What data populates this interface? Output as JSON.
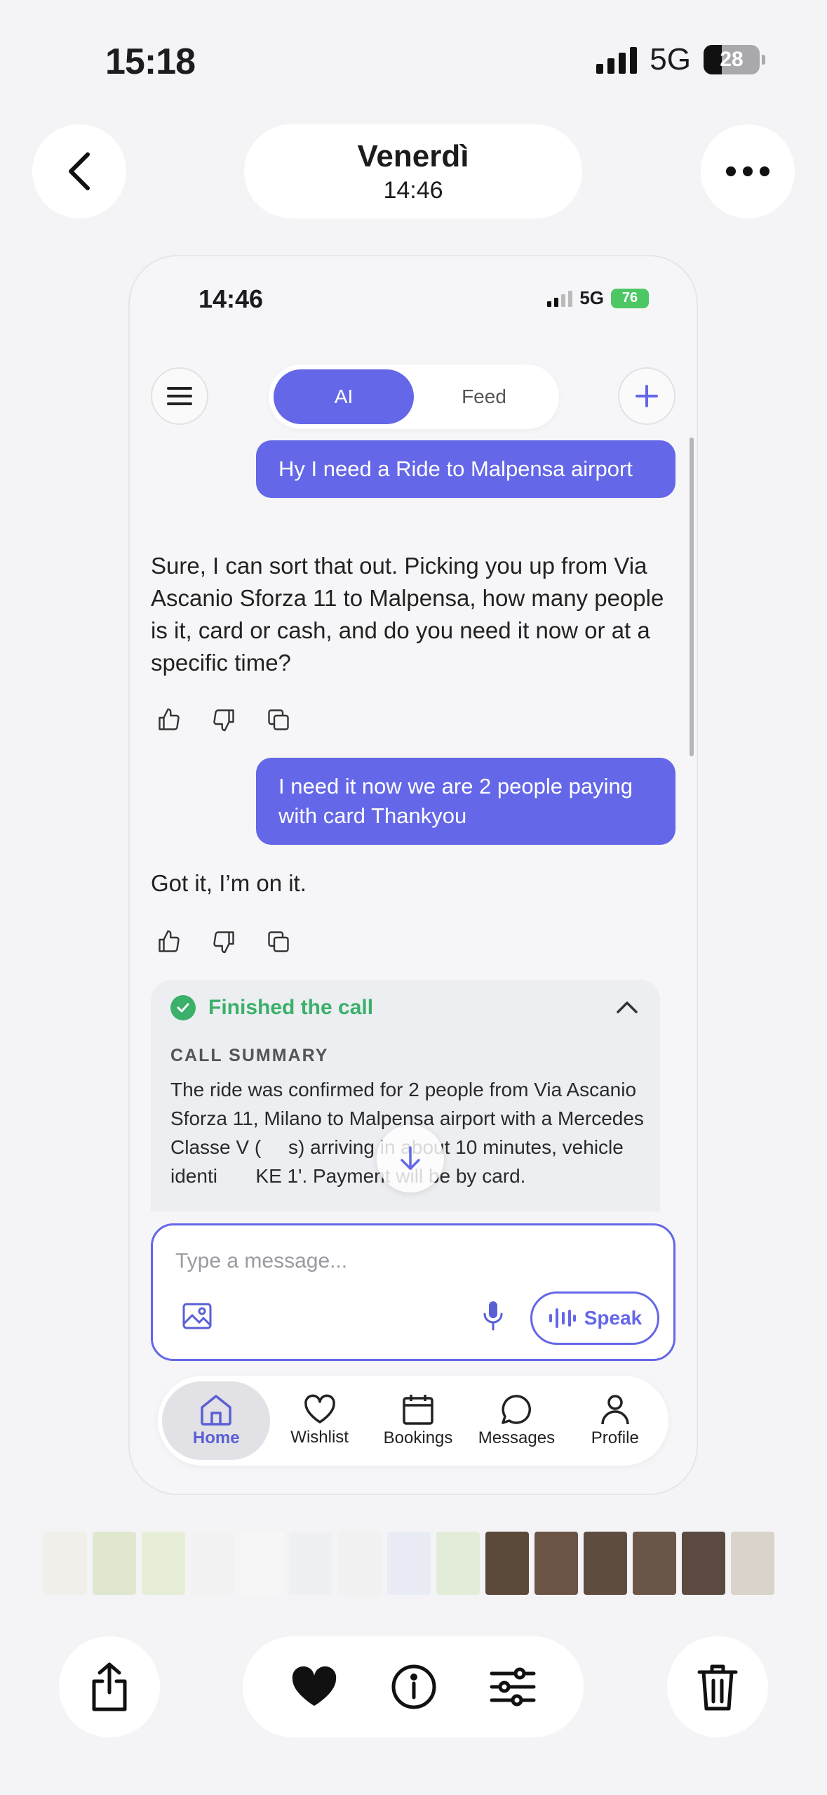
{
  "status_bar": {
    "time": "15:18",
    "network": "5G",
    "battery": "28"
  },
  "header": {
    "title": "Venerdì",
    "subtitle": "14:46"
  },
  "screenshot": {
    "status_bar": {
      "time": "14:46",
      "network": "5G",
      "battery": "76"
    },
    "segment": {
      "ai_label": "AI",
      "feed_label": "Feed",
      "selected": "AI"
    },
    "messages": [
      {
        "role": "user",
        "text": "Hy I need a Ride to Malpensa airport"
      },
      {
        "role": "assistant",
        "text": "Sure, I can sort that out. Picking you up from Via Ascanio Sforza 11 to Malpensa, how many people is it, card or cash, and do you need it now or at a specific time?"
      },
      {
        "role": "user",
        "text": "I need it now we are 2 people paying with card Thankyou"
      },
      {
        "role": "assistant",
        "text": "Got it, I’m on it."
      }
    ],
    "call_card": {
      "status": "Finished the call",
      "summary_label": "CALL SUMMARY",
      "summary_text": "The ride was confirmed for 2 people from Via Ascanio Sforza 11, Milano to Malpensa airport with a Mercedes Classe V (     s) arriving in about 10 minutes, vehicle identi       KE 1'. Payment will be by card."
    },
    "composer": {
      "placeholder": "Type a message...",
      "speak_label": "Speak"
    },
    "tabs": [
      {
        "label": "Home",
        "icon": "home-icon",
        "active": true
      },
      {
        "label": "Wishlist",
        "icon": "heart-icon",
        "active": false
      },
      {
        "label": "Bookings",
        "icon": "calendar-icon",
        "active": false
      },
      {
        "label": "Messages",
        "icon": "chat-bubble-icon",
        "active": false
      },
      {
        "label": "Profile",
        "icon": "person-icon",
        "active": false
      }
    ],
    "accent_color": "#6467e8"
  },
  "thumbnails": [
    "#f0efe9",
    "#dfe8cf",
    "#e7eed8",
    "#f2f2f2",
    "#f7f7f7",
    "#eef0f3",
    "#f1f1f1",
    "#e9ebf5",
    "#e3ecd9",
    "#5b4a3a",
    "#6b5446",
    "#5e4c40",
    "#6a5648",
    "#5a4a42",
    "#d9d3cc"
  ],
  "toolbar_icons": [
    "share-icon",
    "heart-icon",
    "info-icon",
    "sliders-icon",
    "trash-icon"
  ]
}
